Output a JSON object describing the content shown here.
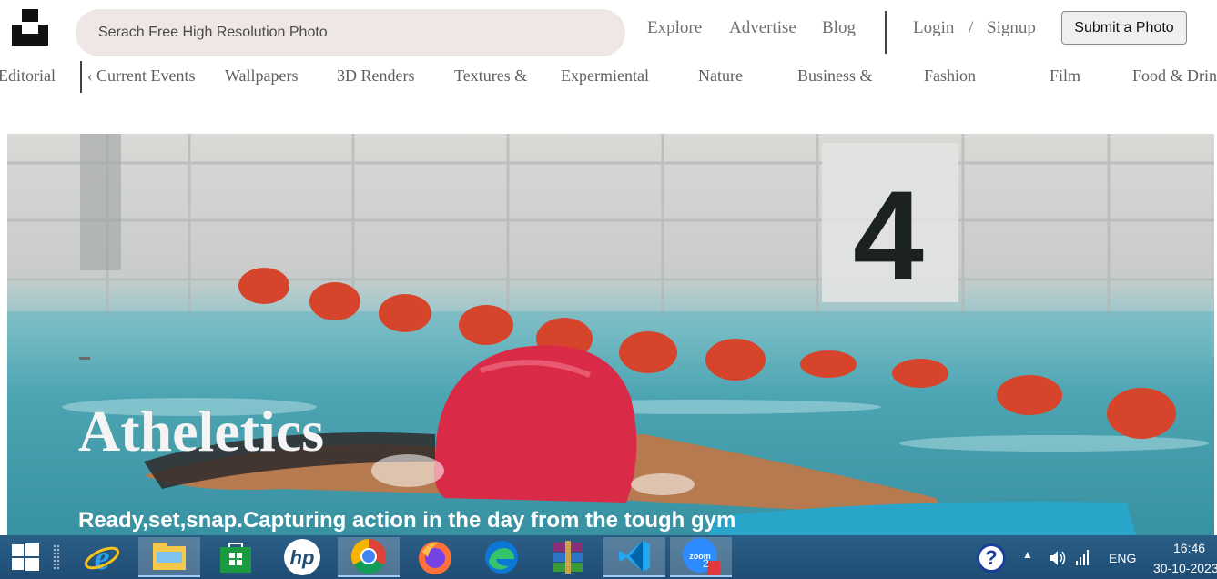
{
  "header": {
    "logo_icon": "unsplash-logo-icon",
    "search_placeholder": "Serach Free High Resolution Photo",
    "nav": {
      "explore": "Explore",
      "advertise": "Advertise",
      "blog": "Blog",
      "login": "Login",
      "separator": "/",
      "signup": "Signup"
    },
    "submit_label": "Submit a Photo"
  },
  "categories": {
    "first": "Editorial",
    "chevron": "‹",
    "items": [
      "Current Events",
      "Wallpapers",
      "3D Renders",
      "Textures &",
      "Expermiental",
      "Nature",
      "Business &",
      "Fashion",
      "Film",
      "Food & Drin"
    ]
  },
  "hero": {
    "title": "Atheletics",
    "subtitle": "Ready,set,snap.Capturing action in the day from the tough gym",
    "lane_number": "4"
  },
  "taskbar": {
    "apps": [
      "windows-start-icon",
      "internet-explorer-icon",
      "file-explorer-icon",
      "microsoft-store-icon",
      "hp-icon",
      "chrome-icon",
      "firefox-icon",
      "edge-icon",
      "winrar-icon",
      "vscode-icon",
      "zoom-icon"
    ],
    "zoom_badge": "2",
    "help": "?",
    "language": "ENG",
    "time": "16:46",
    "date": "30-10-2023"
  },
  "colors": {
    "search_bg": "#efe7e6",
    "nav_text": "#707070",
    "taskbar": "#1f4d74"
  }
}
